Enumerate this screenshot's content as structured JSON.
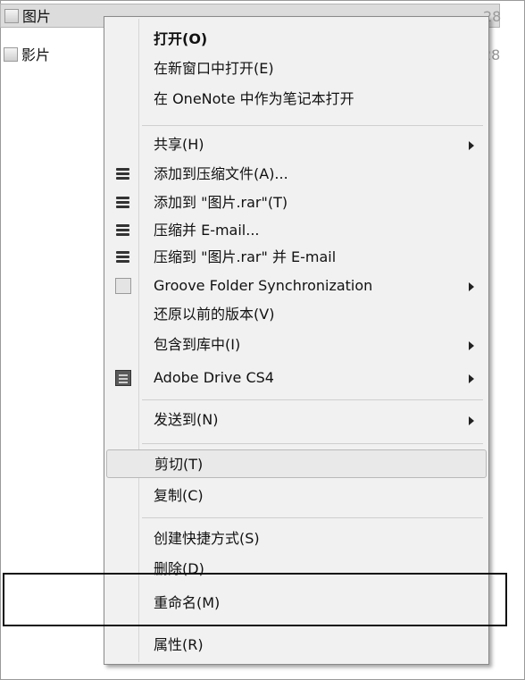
{
  "file_list": [
    {
      "name": "图片",
      "date": "28",
      "selected": true
    },
    {
      "name": "影片",
      "date": "28",
      "selected": false
    }
  ],
  "context_menu": {
    "items": [
      {
        "label": "打开(O)"
      },
      {
        "label": "在新窗口中打开(E)"
      },
      {
        "label": "在 OneNote 中作为笔记本打开"
      },
      {
        "label": "共享(H)",
        "submenu": true
      },
      {
        "label": "添加到压缩文件(A)...",
        "icon": "winrar-icon"
      },
      {
        "label": "添加到 \"图片.rar\"(T)",
        "icon": "winrar-icon"
      },
      {
        "label": "压缩并 E-mail...",
        "icon": "winrar-icon"
      },
      {
        "label": "压缩到 \"图片.rar\" 并 E-mail",
        "icon": "winrar-icon"
      },
      {
        "label": "Groove Folder Synchronization",
        "icon": "groove-icon",
        "submenu": true
      },
      {
        "label": "还原以前的版本(V)"
      },
      {
        "label": "包含到库中(I)",
        "submenu": true
      },
      {
        "label": "Adobe Drive CS4",
        "icon": "adobe-drive-icon",
        "submenu": true
      },
      {
        "label": "发送到(N)",
        "submenu": true
      },
      {
        "label": "剪切(T)",
        "hover": true
      },
      {
        "label": "复制(C)"
      },
      {
        "label": "创建快捷方式(S)"
      },
      {
        "label": "删除(D)"
      },
      {
        "label": "重命名(M)",
        "highlighted": true
      },
      {
        "label": "属性(R)"
      }
    ]
  },
  "colors": {
    "menu_background": "#f1f1f1",
    "highlight_border": "#111111"
  }
}
